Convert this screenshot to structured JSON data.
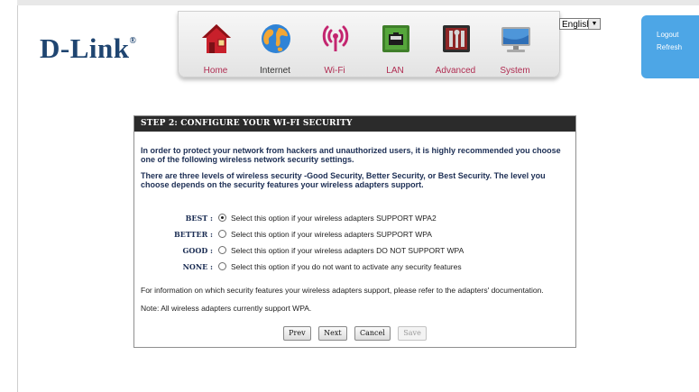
{
  "brand": {
    "logo": "D-Link",
    "reg": "®"
  },
  "nav": {
    "items": [
      {
        "label": "Home",
        "icon": "home-icon"
      },
      {
        "label": "Internet",
        "icon": "globe-icon"
      },
      {
        "label": "Wi-Fi",
        "icon": "wifi-icon"
      },
      {
        "label": "LAN",
        "icon": "lan-port-icon"
      },
      {
        "label": "Advanced",
        "icon": "tools-icon"
      },
      {
        "label": "System",
        "icon": "monitor-icon"
      }
    ]
  },
  "language": {
    "selected": "English"
  },
  "account": {
    "logout": "Logout",
    "refresh": "Refresh"
  },
  "wizard": {
    "title": "STEP 2: CONFIGURE YOUR WI-FI SECURITY",
    "intro1": "In order to protect your network from hackers and unauthorized users, it is highly recommended you choose one of the following wireless network security settings.",
    "intro2": "There are three levels of wireless security -Good Security, Better Security, or Best Security. The level you choose depends on the security features your wireless adapters support.",
    "options": [
      {
        "label": "BEST :",
        "desc": "Select this option if your wireless adapters SUPPORT WPA2",
        "selected": true
      },
      {
        "label": "BETTER :",
        "desc": "Select this option if your wireless adapters SUPPORT WPA",
        "selected": false
      },
      {
        "label": "GOOD :",
        "desc": "Select this option if your wireless adapters DO NOT SUPPORT WPA",
        "selected": false
      },
      {
        "label": "NONE :",
        "desc": "Select this option if you do not want to activate any security features",
        "selected": false
      }
    ],
    "info": "For information on which security features your wireless adapters support, please refer to the adapters' documentation.",
    "note": "Note: All wireless adapters currently support WPA.",
    "buttons": {
      "prev": "Prev",
      "next": "Next",
      "cancel": "Cancel",
      "save": "Save"
    }
  },
  "colors": {
    "nav_label": "#b02d52",
    "panel_title_bg": "#2b2b2b",
    "text_blue": "#1c2e54",
    "side_panel": "#4da6e6",
    "logo": "#1f4571"
  }
}
